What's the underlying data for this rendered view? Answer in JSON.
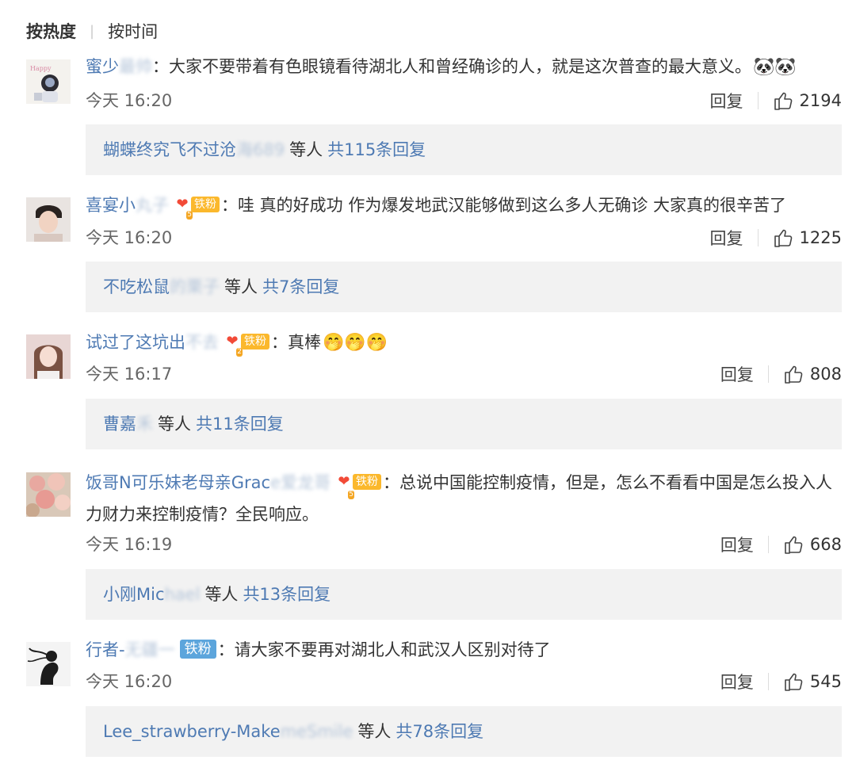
{
  "sort": {
    "active": "按热度",
    "other": "按时间"
  },
  "comments": [
    {
      "username": "蜜少",
      "username_hidden": "最帅",
      "badge": null,
      "text": "：大家不要带着有色眼镜看待湖北人和曾经确诊的人，就是这次普查的最大意义。",
      "emoji": "🐼🐼",
      "time": "今天 16:20",
      "reply_label": "回复",
      "likes": "2194",
      "reply_user": "蝴蝶终究飞不过沧",
      "reply_user_hidden": "海689",
      "reply_etc": "等人",
      "reply_count": "共115条回复"
    },
    {
      "username": "喜宴小",
      "username_hidden": "丸子",
      "badge": "铁粉",
      "badge_level": "5",
      "text": "：哇 真的好成功 作为爆发地武汉能够做到这么多人无确诊 大家真的很辛苦了",
      "emoji": "",
      "time": "今天 16:20",
      "reply_label": "回复",
      "likes": "1225",
      "reply_user": "不吃松鼠",
      "reply_user_hidden": "的栗子",
      "reply_etc": "等人",
      "reply_count": "共7条回复"
    },
    {
      "username": "试过了这坑出",
      "username_hidden": "不去",
      "badge": "铁粉",
      "badge_level": "2",
      "text": "：真棒",
      "emoji": "🤭🤭🤭",
      "time": "今天 16:17",
      "reply_label": "回复",
      "likes": "808",
      "reply_user": "曹嘉",
      "reply_user_hidden": "禾",
      "reply_etc": "等人",
      "reply_count": "共11条回复"
    },
    {
      "username": "饭哥N可乐妹老母亲Grac",
      "username_hidden": "e爱龙哥",
      "badge": "铁粉",
      "badge_level": "5",
      "text": "：总说中国能控制疫情，但是，怎么不看看中国是怎么投入人力财力来控制疫情？全民响应。",
      "emoji": "",
      "time": "今天 16:19",
      "reply_label": "回复",
      "likes": "668",
      "reply_user": "小刚Mic",
      "reply_user_hidden": "hael",
      "reply_etc": "等人",
      "reply_count": "共13条回复"
    },
    {
      "username": "行者-",
      "username_hidden": "无疆一",
      "badge": "铁粉",
      "badge_level": "",
      "text": "：请大家不要再对湖北人和武汉人区别对待了",
      "emoji": "",
      "time": "今天 16:20",
      "reply_label": "回复",
      "likes": "545",
      "reply_user": "Lee_strawberry-Make",
      "reply_user_hidden": "meSmile",
      "reply_etc": "等人",
      "reply_count": "共78条回复"
    }
  ],
  "colors": {
    "link": "#4e7ab3",
    "reply_bg": "#f2f2f2",
    "badge": "#fbb82c",
    "badge_blue": "#5ca5dc"
  }
}
